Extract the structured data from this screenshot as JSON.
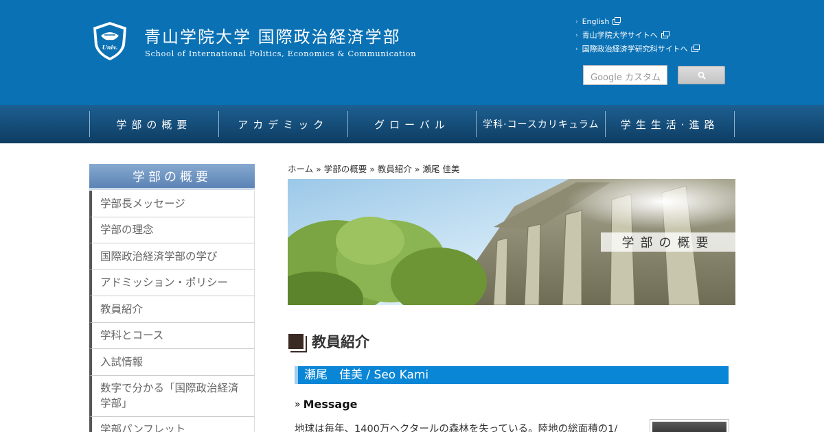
{
  "header": {
    "title_ja": "青山学院大学 国際政治経済学部",
    "title_en": "School of International Politics, Economics & Communication",
    "logo_text": "Univ.",
    "util_links": [
      {
        "label": "English"
      },
      {
        "label": "青山学院大学サイトへ"
      },
      {
        "label": "国際政治経済学研究科サイトへ"
      }
    ],
    "search": {
      "placeholder": "Google カスタム"
    }
  },
  "gnav": {
    "items": [
      {
        "label": "学部の概要"
      },
      {
        "label": "アカデミック"
      },
      {
        "label": "グローバル"
      },
      {
        "label": "学科·コースカリキュラム"
      },
      {
        "label": "学生生活·進路"
      }
    ]
  },
  "sidebar": {
    "heading": "学部の概要",
    "items": [
      {
        "label": "学部長メッセージ"
      },
      {
        "label": "学部の理念"
      },
      {
        "label": "国際政治経済学部の学び"
      },
      {
        "label": "アドミッション・ポリシー"
      },
      {
        "label": "教員紹介"
      },
      {
        "label": "学科とコース"
      },
      {
        "label": "入試情報"
      },
      {
        "label": "数字で分かる「国際政治経済学部」"
      },
      {
        "label": "学部パンフレット"
      }
    ]
  },
  "main": {
    "breadcrumb": "ホーム » 学部の概要 » 教員紹介 » 瀬尾 佳美",
    "hero_label": "学部の概要",
    "page_title": "教員紹介",
    "faculty_name": "瀬尾　佳美 / Seo Kami",
    "message_heading": "Message",
    "message_text": "地球は毎年、1400万ヘクタールの森林を失っている。陸地の総面積の1/"
  },
  "colors": {
    "header_blue": "#0a71b5",
    "nav_dark": "#0e3d62",
    "name_bar": "#0a86d6",
    "sidebar_head": "#6f94c2"
  }
}
